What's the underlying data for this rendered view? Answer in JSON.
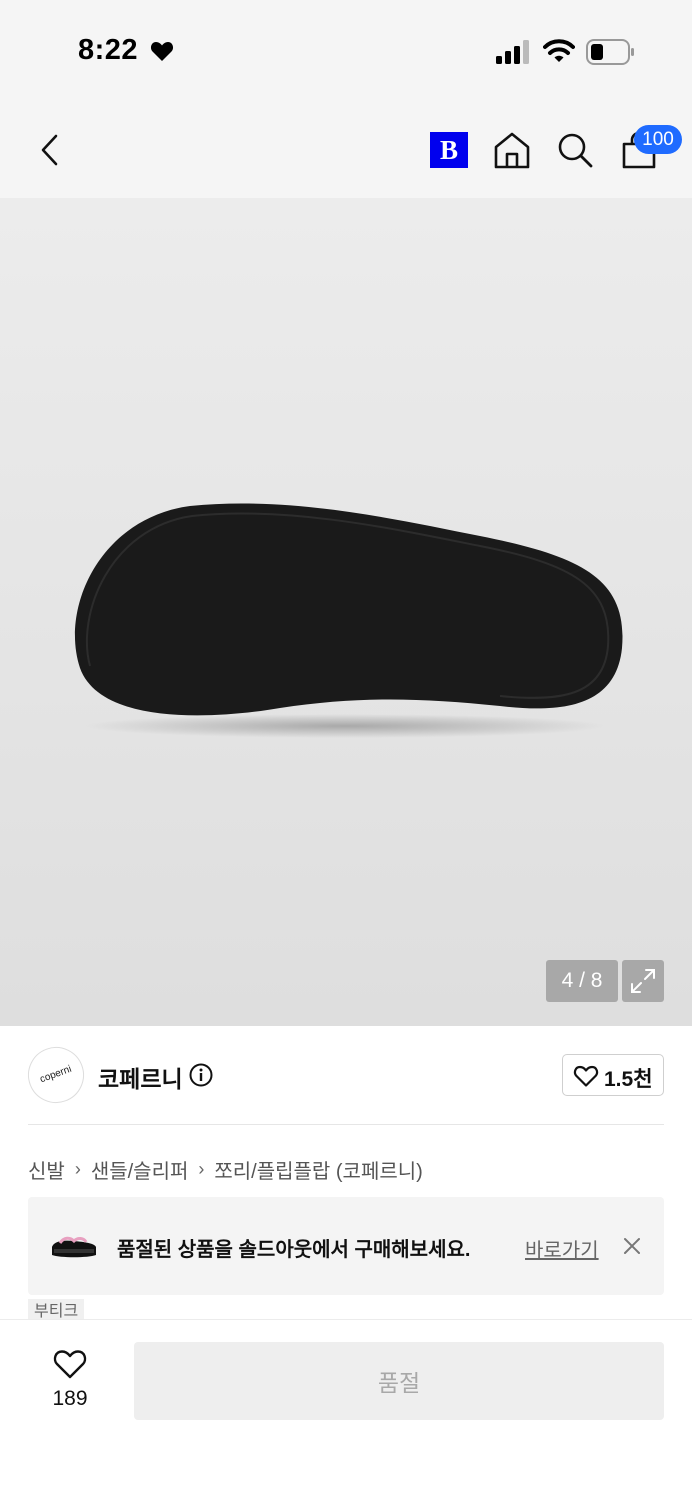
{
  "status_bar": {
    "time": "8:22"
  },
  "nav": {
    "brand_badge": "B",
    "cart_count": "100",
    "icons": [
      "chevron-left-icon",
      "home-icon",
      "search-icon",
      "shopping-bag-icon"
    ]
  },
  "gallery": {
    "counter": "4 / 8"
  },
  "brand": {
    "logo_text": "coperni",
    "name": "코페르니",
    "likes": "1.5천"
  },
  "breadcrumb": [
    "신발",
    "샌들/슬리퍼",
    "쪼리/플립플랍 (코페르니)"
  ],
  "banner": {
    "text": "품절된 상품을 솔드아웃에서 구매해보세요.",
    "link": "바로가기"
  },
  "boutique_tag": "부티크",
  "bottom": {
    "like_count": "189",
    "button_label": "품절"
  },
  "colors": {
    "accent": "#1f6bff",
    "brand_badge_bg": "#0000ee",
    "disabled_bg": "#eeeeee",
    "disabled_text": "#a8a8a8"
  }
}
